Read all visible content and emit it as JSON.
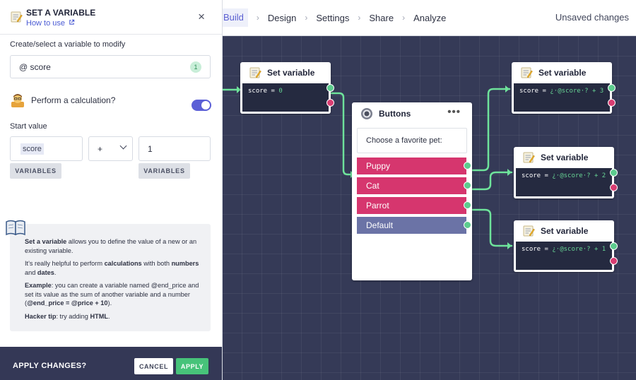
{
  "nav": {
    "items": [
      {
        "label": "Build"
      },
      {
        "label": "Design"
      },
      {
        "label": "Settings"
      },
      {
        "label": "Share"
      },
      {
        "label": "Analyze"
      }
    ],
    "separator": "›",
    "status": "Unsaved changes"
  },
  "panel": {
    "title": "SET A VARIABLE",
    "how_to": "How to use",
    "close": "×",
    "var_section_label": "Create/select a variable to modify",
    "var_value": "@  score",
    "var_count": "1",
    "calc_label": "Perform a calculation?",
    "calc_enabled": true,
    "start_label": "Start value",
    "start_left_value": "score",
    "operator": "+",
    "start_right_value": "1",
    "variables_button": "VARIABLES",
    "help": {
      "p1_bold": "Set a variable",
      "p1_rest": " allows you to define the value of a new or an existing variable.",
      "p2_a": "It's really helpful to perform ",
      "p2_b": "calculations",
      "p2_c": " with both ",
      "p2_d": "numbers",
      "p2_e": " and ",
      "p2_f": "dates",
      "p2_g": ".",
      "p3_bold": "Example",
      "p3_a": ": you can create a variable named @end_price and set its value as the sum of another variable and a number (",
      "p3_b": "@end_price = @price + 10",
      "p3_c": ").",
      "p4_bold": "Hacker tip",
      "p4_a": ": try adding ",
      "p4_b": "HTML",
      "p4_c": "."
    },
    "footer": {
      "label": "APPLY CHANGES?",
      "cancel": "CANCEL",
      "apply": "APPLY"
    }
  },
  "canvas": {
    "node_set1": {
      "title": "Set variable",
      "code_var": "score",
      "code_eq": " = ",
      "code_val": "0"
    },
    "node_buttons": {
      "title": "Buttons",
      "more": "•••",
      "prompt": "Choose a favorite pet:",
      "choices": [
        {
          "label": "Puppy"
        },
        {
          "label": "Cat"
        },
        {
          "label": "Parrot"
        },
        {
          "label": "Default"
        }
      ]
    },
    "node_set2": {
      "title": "Set variable",
      "code_var": "score",
      "code_eq": " = ",
      "code_val": "¿·@score·? + 3"
    },
    "node_set3": {
      "title": "Set variable",
      "code_var": "score",
      "code_eq": " = ",
      "code_val": "¿·@score·? + 2"
    },
    "node_set4": {
      "title": "Set variable",
      "code_var": "score",
      "code_eq": " = ",
      "code_val": "¿·@score·? + 1"
    }
  },
  "colors": {
    "accent": "#5b5fd6",
    "canvas_bg": "#353a57",
    "connector": "#6ee39b",
    "choice_pink": "#d6366e",
    "choice_default": "#6b73a6",
    "apply_green": "#47c37a"
  }
}
